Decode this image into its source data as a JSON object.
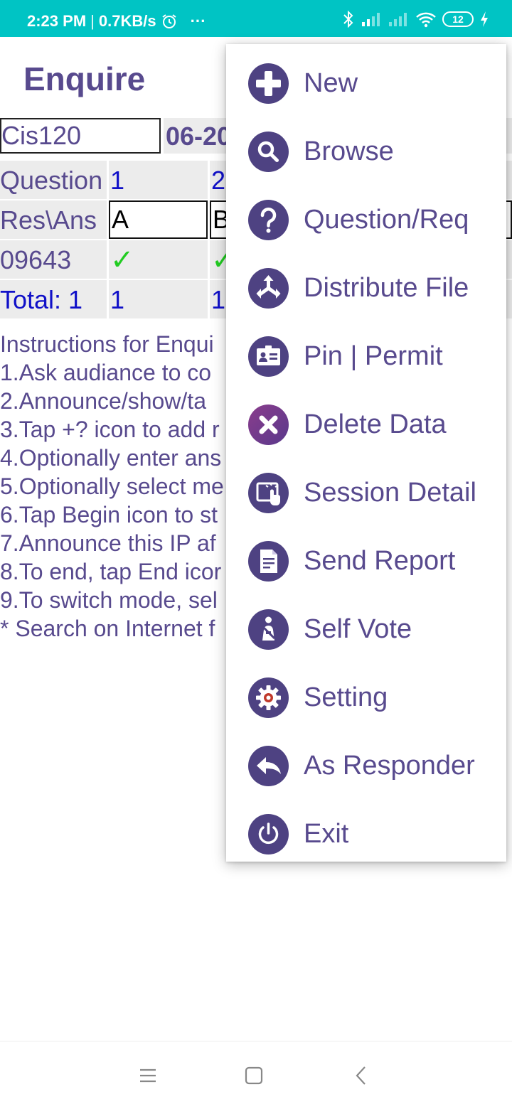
{
  "status_bar": {
    "time": "2:23 PM",
    "separator": "|",
    "speed": "0.7KB/s",
    "more": "···",
    "battery": "12",
    "icons": [
      "alarm-icon",
      "bluetooth-icon",
      "signal-icon",
      "signal-x-icon",
      "wifi-icon",
      "battery-icon",
      "charging-icon"
    ],
    "bg_color": "#00c4c4"
  },
  "app": {
    "title": "Enquire"
  },
  "session": {
    "code": "Cis120",
    "date": "06-20"
  },
  "table": {
    "question_label": "Question",
    "questions": [
      "1",
      "2"
    ],
    "res_label": "Res\\Ans",
    "answers": [
      "A",
      "B"
    ],
    "responder": "09643",
    "marks": [
      "✓",
      "✓"
    ],
    "total_label": "Total: 1",
    "totals": [
      "1",
      "1"
    ]
  },
  "instructions": [
    "Instructions for Enqui",
    "1.Ask audiance to co",
    "2.Announce/show/ta",
    "3.Tap +? icon to add r",
    "4.Optionally enter ans",
    "5.Optionally select me",
    "6.Tap Begin icon to st",
    "7.Announce this IP af",
    "8.To end, tap End icor",
    "9.To switch mode, sel",
    "* Search on Internet f"
  ],
  "menu": {
    "items": [
      {
        "label": "New",
        "icon": "plus-icon"
      },
      {
        "label": "Browse",
        "icon": "magnifier-icon"
      },
      {
        "label": "Question/Req",
        "icon": "question-icon"
      },
      {
        "label": "Distribute File",
        "icon": "distribute-arrows-icon"
      },
      {
        "label": "Pin | Permit",
        "icon": "id-card-icon"
      },
      {
        "label": "Delete Data",
        "icon": "delete-x-icon"
      },
      {
        "label": "Session Detail",
        "icon": "touch-screen-icon"
      },
      {
        "label": "Send Report",
        "icon": "document-icon"
      },
      {
        "label": "Self Vote",
        "icon": "seatbelt-person-icon"
      },
      {
        "label": "Setting",
        "icon": "gear-icon"
      },
      {
        "label": "As Responder",
        "icon": "reply-arrow-icon"
      },
      {
        "label": "Exit",
        "icon": "power-icon"
      }
    ],
    "accent": "#4e4282",
    "text_color": "#584a8e"
  },
  "nav": {
    "icons": [
      "menu-lines-icon",
      "home-square-icon",
      "back-chevron-icon"
    ]
  }
}
